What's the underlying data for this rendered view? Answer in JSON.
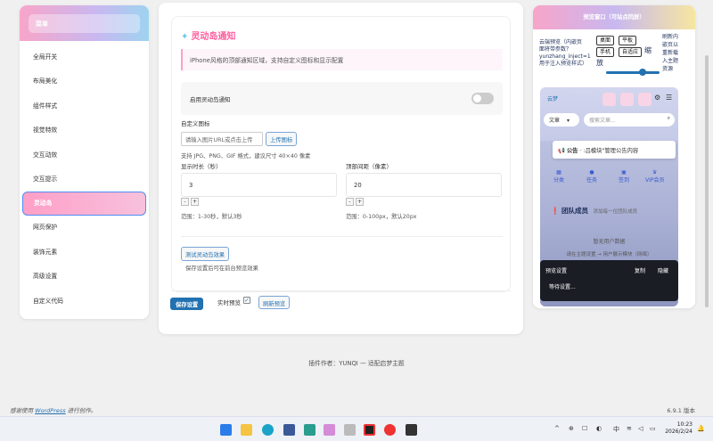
{
  "menu": {
    "header": "菜单",
    "items": [
      {
        "label": "全局开关"
      },
      {
        "label": "布局美化"
      },
      {
        "label": "组件样式"
      },
      {
        "label": "视觉特效"
      },
      {
        "label": "交互动效"
      },
      {
        "label": "交互提示"
      },
      {
        "label": "灵动岛",
        "active": true
      },
      {
        "label": "网页保护"
      },
      {
        "label": "装饰元素"
      },
      {
        "label": "高级设置"
      },
      {
        "label": "自定义代码"
      }
    ]
  },
  "section": {
    "title": "灵动岛通知",
    "description": "iPhone风格的顶部通知区域，支持自定义图标和显示配置",
    "enable_label": "启用灵动岛通知",
    "enable_value": false,
    "icon_label": "自定义图标",
    "icon_placeholder": "请输入图片URL或点击上传",
    "upload_button": "上传图标",
    "icon_hint": "支持 JPG、PNG、GIF 格式，建议尺寸 40×40 像素",
    "duration_label": "显示时长（秒）",
    "duration_value": "3",
    "duration_hint": "范围：1-30秒，默认3秒",
    "top_label": "顶部间距（像素）",
    "top_value": "20",
    "top_hint": "范围：0-100px，默认20px",
    "test_button": "测试灵动岛效果",
    "test_hint": "保存设置后可在前台预览效果"
  },
  "actions": {
    "save": "保存设置",
    "live_preview_label": "实时预览",
    "live_preview_checked": true,
    "refresh": "刷新预览"
  },
  "preview": {
    "title": "预览窗口（可站点同屏）",
    "info_lines": [
      "云端预览（内嵌页",
      "面将带参数？",
      "yunzhang_inject=1",
      "用于注入预览样式）"
    ],
    "devices": [
      "桌面",
      "平板",
      "手机",
      "自适应"
    ],
    "zoom_label": "缩放",
    "side_text": [
      "刷新内",
      "嵌页以",
      "重新载",
      "入主题",
      "资源"
    ],
    "phone": {
      "logo_alt": "云梦",
      "select": "文章",
      "search_placeholder": "搜索文章...",
      "notice_tag": "公告",
      "notice_text": "· :吕模块\"管理公告内容",
      "nav": [
        "分类",
        "任务",
        "签到",
        "VIP会员"
      ],
      "members_title": "团队成员",
      "members_sub": "添加每一位团队成员",
      "empty_text": "暂无用户数据",
      "hint_text": "请在主题设置 → 用户展示模块（网络）",
      "panel_title": "预览设置",
      "panel_copy": "复制",
      "panel_hide": "隐藏",
      "panel_body": "等待设置..."
    }
  },
  "footer": {
    "author": "插件作者：YUNQI — 适配启梦主题",
    "wp_prefix": "感谢使用 ",
    "wp_link": "WordPress",
    "wp_suffix": " 进行创作。",
    "version": "6.9.1 版本"
  },
  "taskbar": {
    "tray_lang": "中",
    "time": "10:23",
    "date": "2026/2/24"
  },
  "colors": {
    "accent_pink": "#ff5d9e",
    "wp_blue": "#2271b1",
    "active_border": "#4f8df7"
  }
}
